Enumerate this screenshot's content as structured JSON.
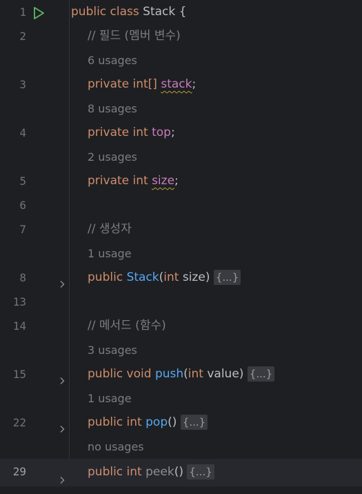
{
  "editor": {
    "lines": {
      "l1": {
        "num": "1",
        "t1": "public class ",
        "t2": "Stack {"
      },
      "l2": {
        "num": "2",
        "comment": "// 필드 (멤버 변수)"
      },
      "h1": {
        "hint": "6 usages"
      },
      "l3": {
        "num": "3",
        "kw": "private int[] ",
        "name": "stack",
        "end": ";"
      },
      "h2": {
        "hint": "8 usages"
      },
      "l4": {
        "num": "4",
        "kw": "private int ",
        "name": "top",
        "end": ";"
      },
      "h3": {
        "hint": "2 usages"
      },
      "l5": {
        "num": "5",
        "kw": "private int ",
        "name": "size",
        "end": ";"
      },
      "l6": {
        "num": "6"
      },
      "l7": {
        "num": "7",
        "comment": "// 생성자"
      },
      "h4": {
        "hint": "1 usage"
      },
      "l8": {
        "num": "8",
        "kw": "public ",
        "name": "Stack",
        "p1": "(",
        "pkw": "int",
        "p2": " size) ",
        "fold": "{...}"
      },
      "l13": {
        "num": "13"
      },
      "l14": {
        "num": "14",
        "comment": "// 메서드 (함수)"
      },
      "h5": {
        "hint": "3 usages"
      },
      "l15": {
        "num": "15",
        "kw": "public void ",
        "name": "push",
        "p1": "(",
        "pkw": "int",
        "p2": " value) ",
        "fold": "{...}"
      },
      "h6": {
        "hint": "1 usage"
      },
      "l22": {
        "num": "22",
        "kw": "public int ",
        "name": "pop",
        "p1": "() ",
        "fold": "{...}"
      },
      "h7": {
        "hint": "no usages"
      },
      "l29": {
        "num": "29",
        "kw": "public int ",
        "name": "peek",
        "p1": "() ",
        "fold": "{...}"
      }
    }
  },
  "colors": {
    "background": "#1e1f22",
    "keyword": "#cf8e6d",
    "field": "#c77dbb",
    "method": "#56a8f5",
    "comment": "#7a7e85",
    "run_icon": "#5fb865"
  },
  "icons": {
    "run": "run-gutter-icon",
    "fold": "fold-chevron-icon"
  }
}
